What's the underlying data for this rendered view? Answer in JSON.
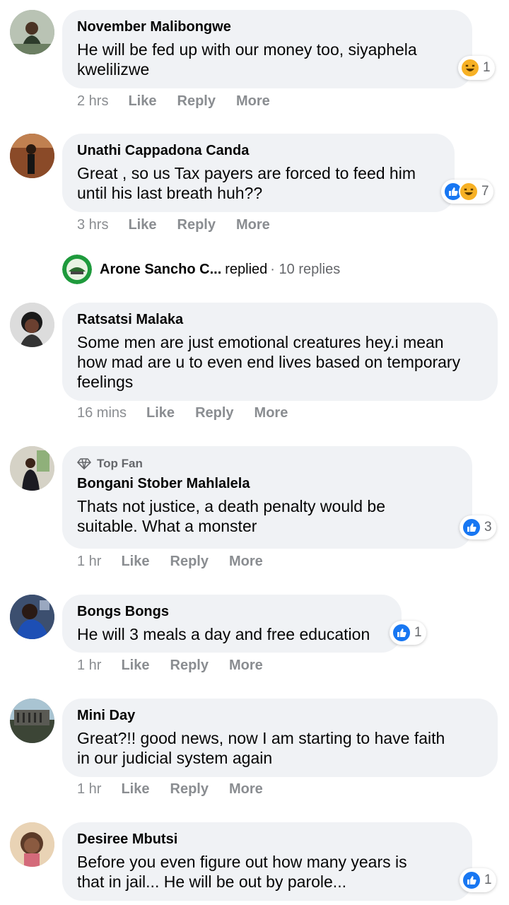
{
  "comments": [
    {
      "name": "November Malibongwe",
      "text": "He will be fed up with our money too, siyaphela\nkwelilizwe",
      "time": "2 hrs",
      "like": "Like",
      "reply": "Reply",
      "more": "More",
      "reaction_count": "1"
    },
    {
      "name": "Unathi Cappadona Canda",
      "text": "Great , so us Tax payers are forced to feed him\nuntil his last breath huh??",
      "time": "3 hrs",
      "like": "Like",
      "reply": "Reply",
      "more": "More",
      "reaction_count": "7"
    },
    {
      "name": "Ratsatsi Malaka",
      "text": "Some men are just emotional creatures hey.i mean\nhow mad are u to even end lives based on temporary\nfeelings",
      "time": "16 mins",
      "like": "Like",
      "reply": "Reply",
      "more": "More"
    },
    {
      "badge": "Top Fan",
      "name": "Bongani Stober Mahlalela",
      "text": "Thats not justice, a death penalty would be\nsuitable. What a monster",
      "time": "1 hr",
      "like": "Like",
      "reply": "Reply",
      "more": "More",
      "reaction_count": "3"
    },
    {
      "name": "Bongs Bongs",
      "text": "He will 3 meals a day and free education",
      "time": "1 hr",
      "like": "Like",
      "reply": "Reply",
      "more": "More",
      "reaction_count": "1"
    },
    {
      "name": "Mini Day",
      "text": "Great?!! good news, now I am starting to have faith\nin our judicial system again",
      "time": "1 hr",
      "like": "Like",
      "reply": "Reply",
      "more": "More"
    },
    {
      "name": "Desiree Mbutsi",
      "text": "Before you even figure out how many years is\nthat in jail... He will be out by parole...",
      "reaction_count": "1"
    }
  ],
  "replied": {
    "name": "Arone Sancho C...",
    "verb": "replied",
    "count": "· 10 replies"
  },
  "colors": {
    "like": "#1877f2",
    "haha": "#f7b125",
    "bubble": "#f0f2f5",
    "meta": "#8a8d91"
  }
}
